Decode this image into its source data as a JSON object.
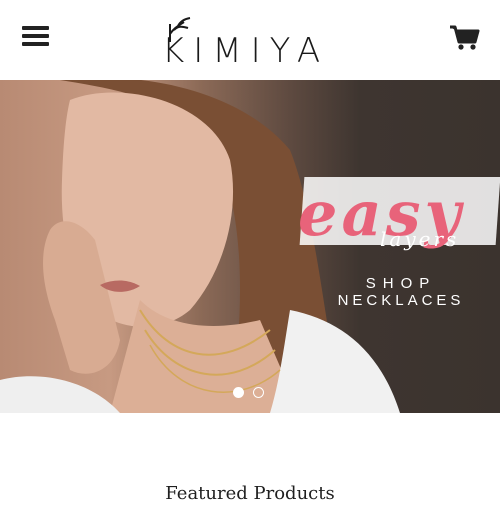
{
  "header": {
    "menu_icon": "hamburger-menu-icon",
    "logo_text": "KIMIYA",
    "cart_icon": "cart-icon"
  },
  "hero": {
    "headline": "easy",
    "subhead": "layers",
    "cta_line1": "SHOP",
    "cta_line2": "NECKLACES",
    "accent_color": "#e8637a",
    "slides": [
      {
        "state": "active"
      },
      {
        "state": "inactive"
      }
    ]
  },
  "featured": {
    "title": "Featured Products"
  }
}
